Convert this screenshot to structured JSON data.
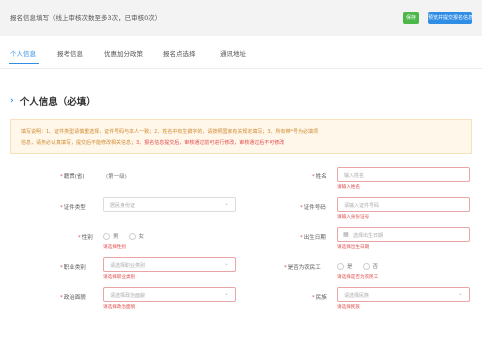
{
  "header": {
    "title": "报名信息填写（线上审核次数至多3次，已审核0次）",
    "btn_primary": "保存",
    "btn_secondary": "预览并提交报名信息"
  },
  "tabs": [
    {
      "label": "个人信息",
      "active": true
    },
    {
      "label": "报考信息",
      "active": false
    },
    {
      "label": "优惠加分政策",
      "active": false
    },
    {
      "label": "报名点选择",
      "active": false
    },
    {
      "label": "通讯地址",
      "active": false
    }
  ],
  "section": {
    "title": "个人信息（必填）"
  },
  "notice": {
    "line1": "填写说明：1、证件类型请慎重选择，证件号码与本人一致；2、姓名中有生僻字的，请按照国家有关规定填写；3、所有带*号为必填项",
    "line2": "信息，请务必认真填写，提交后不能修改相关信息；",
    "line2_red": "3、报名信息提交后，审核通过前可进行修改，审核通过后不可修改"
  },
  "form": {
    "origin": {
      "label": "籍贯(省)",
      "value": "(第一级)"
    },
    "name": {
      "label": "姓名",
      "placeholder": "输入姓名",
      "error": "请输入姓名"
    },
    "id_type": {
      "label": "证件类型",
      "placeholder": "居民身份证"
    },
    "id_number": {
      "label": "证件号码",
      "placeholder": "请输入证件号码",
      "error": "请输入身份证号"
    },
    "gender": {
      "label": "性别",
      "options": [
        "男",
        "女"
      ],
      "error": "请选择性别"
    },
    "birth_date": {
      "label": "出生日期",
      "placeholder": "选择出生日期",
      "error": "请选择出生日期"
    },
    "occupation": {
      "label": "职业类别",
      "placeholder": "请选择职业类别",
      "error": "请选择职业类别"
    },
    "migrant": {
      "label": "是否为农民工",
      "options": [
        "是",
        "否"
      ],
      "error": "请选择是否为农民工"
    },
    "political": {
      "label": "政治面貌",
      "placeholder": "请选择政治面貌",
      "error": "请选择政治面貌"
    },
    "ethnicity": {
      "label": "民族",
      "placeholder": "请选择民族",
      "error": "请选择民族"
    }
  },
  "colors": {
    "accent": "#2f8de4",
    "save_button": "#4cb84a",
    "error": "#e34c4c",
    "notice_bg": "#fff7ea"
  }
}
